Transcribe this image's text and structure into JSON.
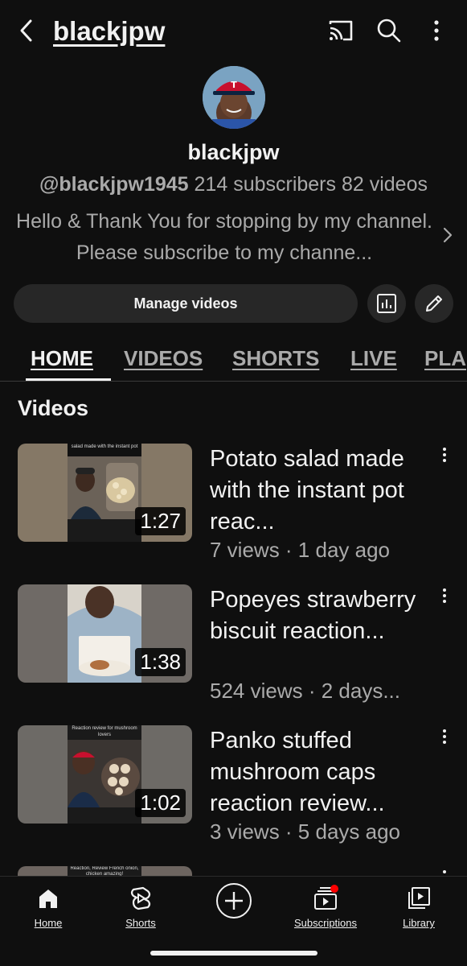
{
  "header": {
    "title": "blackjpw",
    "icons": [
      "back-icon",
      "cast-icon",
      "search-icon",
      "more-icon"
    ]
  },
  "channel": {
    "name": "blackjpw",
    "handle": "@blackjpw1945",
    "subscribers": "214 subscribers",
    "videos_count": "82 videos",
    "description": "Hello & Thank You for stopping by my channel. Please subscribe to my channe..."
  },
  "actions": {
    "manage_label": "Manage videos"
  },
  "tabs": [
    {
      "label": "HOME"
    },
    {
      "label": "VIDEOS"
    },
    {
      "label": "SHORTS"
    },
    {
      "label": "LIVE"
    },
    {
      "label": "PLA"
    }
  ],
  "section": {
    "title": "Videos"
  },
  "videos": [
    {
      "title": "Potato salad made with the instant pot reac...",
      "meta": "7 views · 1 day ago",
      "duration": "1:27",
      "thumb_caption": "salad made with the instant pot"
    },
    {
      "title": "Popeyes strawberry biscuit reaction...",
      "meta": "524 views · 2 days...",
      "duration": "1:38"
    },
    {
      "title": "Panko stuffed mushroom caps reaction review...",
      "meta": "3 views · 5 days ago",
      "duration": "1:02",
      "thumb_caption": "Reaction review for mushroom lovers"
    }
  ],
  "partial_video": {
    "thumb_caption": "Reaction, Review French onion, chicken amazing!"
  },
  "bottom_nav": [
    {
      "label": "Home",
      "icon": "home-icon"
    },
    {
      "label": "Shorts",
      "icon": "shorts-icon"
    },
    {
      "label": "",
      "icon": "create-icon"
    },
    {
      "label": "Subscriptions",
      "icon": "subscriptions-icon"
    },
    {
      "label": "Library",
      "icon": "library-icon"
    }
  ],
  "colors": {
    "background": "#0f0f0f",
    "surface": "#272727",
    "text": "#f1f1f1",
    "secondary_text": "#aaaaaa",
    "notification_dot": "#ff0000"
  }
}
